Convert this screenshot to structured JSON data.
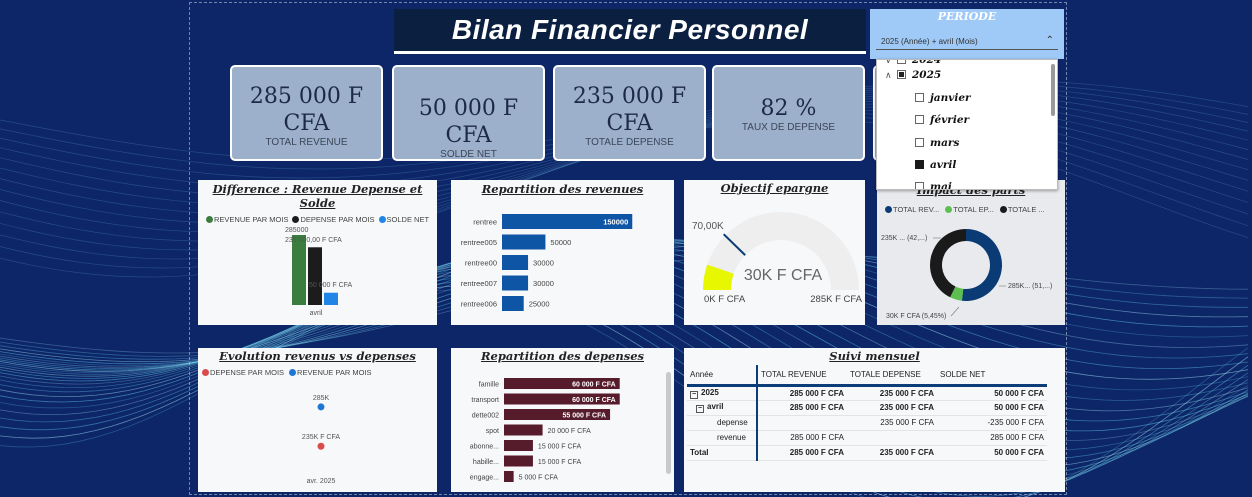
{
  "header": {
    "title": "Bilan Financier Personnel"
  },
  "kpis": [
    {
      "value": "285 000 F CFA",
      "label": "TOTAL REVENUE"
    },
    {
      "value": "50 000 F CFA",
      "label": "SOLDE NET"
    },
    {
      "value": "235 000 F CFA",
      "label": "TOTALE DEPENSE"
    },
    {
      "value": "82 %",
      "label": "TAUX DE DEPENSE"
    }
  ],
  "periode": {
    "title": "PERIODE",
    "selected": "2025 (Année) + avril (Mois)",
    "items": [
      {
        "label": "2024",
        "state": "unchecked",
        "level": 0
      },
      {
        "label": "2025",
        "state": "partial",
        "level": 0
      },
      {
        "label": "janvier",
        "state": "unchecked",
        "level": 1
      },
      {
        "label": "février",
        "state": "unchecked",
        "level": 1
      },
      {
        "label": "mars",
        "state": "unchecked",
        "level": 1
      },
      {
        "label": "avril",
        "state": "checked",
        "level": 1
      },
      {
        "label": "mai",
        "state": "unchecked",
        "level": 1
      }
    ]
  },
  "difference": {
    "title": "Difference : Revenue Depense et Solde",
    "legend": [
      "REVENUE PAR MOIS",
      "DEPENSE PAR MOIS",
      "SOLDE NET"
    ],
    "labels": [
      "285000",
      "235 000,00 F CFA",
      "50 000 F CFA"
    ],
    "xlabel": "avril"
  },
  "revenues": {
    "title": "Repartition des revenues"
  },
  "epargne": {
    "title": "Objectif epargne",
    "target_label": "70,00K",
    "value_label": "30K F CFA",
    "min_label": "0K F CFA",
    "max_label": "285K F CFA"
  },
  "impact": {
    "title": "Impact des parts",
    "legend": [
      "TOTAL REV...",
      "TOTAL EP...",
      "TOTALE ..."
    ],
    "label_depense": "235K ... (42,...)",
    "label_revenue": "285K... (51,...)",
    "label_epargne": "30K F CFA (5,45%)"
  },
  "evolution": {
    "title": "Evolution revenus vs depenses",
    "legend": [
      "DEPENSE PAR MOIS",
      "REVENUE PAR MOIS"
    ],
    "label_revenue": "285K",
    "label_depense": "235K F CFA",
    "xlabel": "avr. 2025"
  },
  "depenses": {
    "title": "Repartition des depenses"
  },
  "suivi": {
    "title": "Suivi mensuel",
    "columns": [
      "Année",
      "TOTAL REVENUE",
      "TOTALE DEPENSE",
      "SOLDE NET"
    ],
    "rows": [
      {
        "label": "2025",
        "c1": "285 000 F CFA",
        "c2": "235 000 F CFA",
        "c3": "50 000 F CFA"
      },
      {
        "label": "avril",
        "c1": "285 000 F CFA",
        "c2": "235 000 F CFA",
        "c3": "50 000 F CFA"
      },
      {
        "label": "depense",
        "c1": "",
        "c2": "235 000 F CFA",
        "c3": "-235 000 F CFA"
      },
      {
        "label": "revenue",
        "c1": "285 000 F CFA",
        "c2": "",
        "c3": "285 000 F CFA"
      },
      {
        "label": "Total",
        "c1": "285 000 F CFA",
        "c2": "235 000 F CFA",
        "c3": "50 000 F CFA"
      }
    ]
  },
  "colors": {
    "background": "#0d2668",
    "kpi_card": "#9db0cb",
    "revenue_green": "#3b7d3e",
    "depense_black": "#1c1c1c",
    "solde_blue": "#2185e6",
    "revenue_bar": "#0f55a5",
    "depense_bar": "#571c2c",
    "gauge_yellow": "#e6f700",
    "donut_navy": "#0b3b74",
    "donut_green": "#5cbf4f",
    "donut_black": "#1a1a1a"
  },
  "chart_data": [
    {
      "type": "bar",
      "title": "Difference : Revenue Depense et Solde",
      "categories": [
        "avril"
      ],
      "series": [
        {
          "name": "REVENUE PAR MOIS",
          "values": [
            285000
          ]
        },
        {
          "name": "DEPENSE PAR MOIS",
          "values": [
            235000
          ]
        },
        {
          "name": "SOLDE NET",
          "values": [
            50000
          ]
        }
      ]
    },
    {
      "type": "bar",
      "title": "Repartition des revenues",
      "orientation": "horizontal",
      "categories": [
        "rentree",
        "rentree005",
        "rentree00",
        "rentree007",
        "rentree006"
      ],
      "values": [
        150000,
        50000,
        30000,
        30000,
        25000
      ],
      "value_labels": [
        "150000",
        "50000",
        "30000",
        "30000",
        "25000"
      ],
      "xlim": [
        0,
        190000
      ]
    },
    {
      "type": "gauge",
      "title": "Objectif epargne",
      "value": 30000,
      "target": 70000,
      "min": 0,
      "max": 285000
    },
    {
      "type": "pie",
      "title": "Impact des parts",
      "donut": true,
      "categories": [
        "TOTAL REV...",
        "TOTAL EP...",
        "TOTALE ..."
      ],
      "values": [
        285000,
        30000,
        235000
      ]
    },
    {
      "type": "scatter",
      "title": "Evolution revenus vs depenses",
      "categories": [
        "avr. 2025"
      ],
      "series": [
        {
          "name": "DEPENSE PAR MOIS",
          "values": [
            235000
          ]
        },
        {
          "name": "REVENUE PAR MOIS",
          "values": [
            285000
          ]
        }
      ]
    },
    {
      "type": "bar",
      "title": "Repartition des depenses",
      "orientation": "horizontal",
      "categories": [
        "famille",
        "transport",
        "dette002",
        "spot",
        "abonne...",
        "habille...",
        "engage..."
      ],
      "values": [
        60000,
        60000,
        55000,
        20000,
        15000,
        15000,
        5000
      ],
      "value_labels": [
        "60 000 F CFA",
        "60 000 F CFA",
        "55 000 F CFA",
        "20 000 F CFA",
        "15 000 F CFA",
        "15 000 F CFA",
        "5 000 F CFA"
      ],
      "xlim": [
        0,
        70000
      ]
    }
  ]
}
